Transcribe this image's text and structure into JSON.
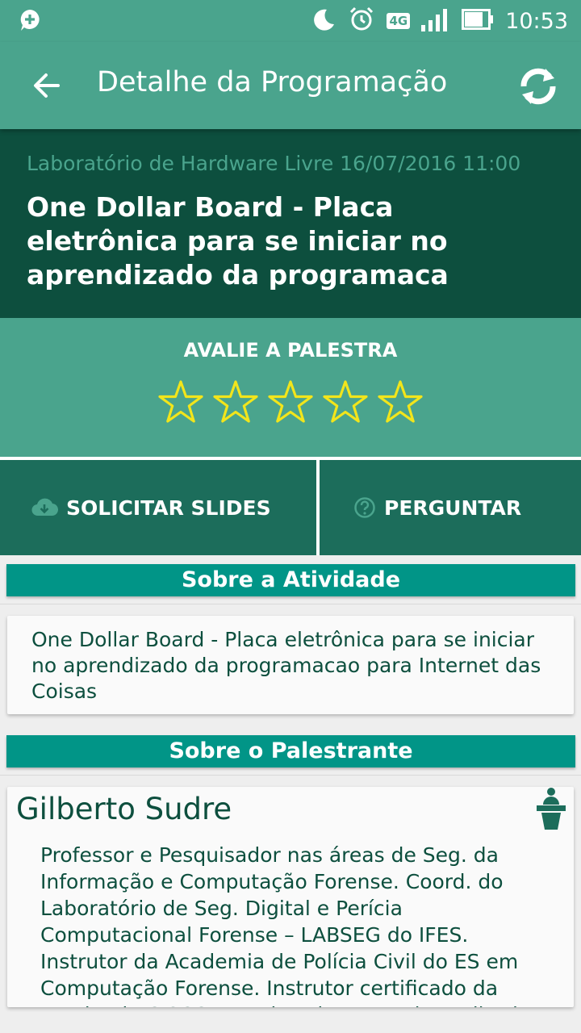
{
  "status_bar": {
    "time": "10:53",
    "network": "4G"
  },
  "app_bar": {
    "title": "Detalhe da Programação"
  },
  "talk": {
    "meta": "Laboratório de Hardware Livre 16/07/2016 11:00",
    "title": "One Dollar Board - Placa eletrônica para se iniciar no aprendizado da programaca"
  },
  "rating": {
    "label": "AVALIE A PALESTRA",
    "stars_total": 5,
    "stars_selected": 0,
    "star_color": "#f2e51b"
  },
  "actions": {
    "slides_label": "SOLICITAR SLIDES",
    "ask_label": "PERGUNTAR"
  },
  "activity": {
    "header": "Sobre a Atividade",
    "text": "One Dollar Board - Placa eletrônica para se iniciar no aprendizado da programacao para Internet das Coisas"
  },
  "speaker": {
    "header": "Sobre o Palestrante",
    "name": "Gilberto Sudre",
    "bio": "Professor e Pesquisador nas áreas de Seg. da Informação e Computação Forense. Coord. do Laboratório de Seg. Digital e Perícia Computacional Forense – LABSEG do IFES. Instrutor da Academia de Polícia Civil do ES em Computação Forense. Instrutor certificado da Academia CISCO. Membro do grupo de Auditoria"
  },
  "colors": {
    "primary": "#4aa48d",
    "dark": "#0d4f3e",
    "action": "#1c6d5b",
    "section": "#019587"
  }
}
